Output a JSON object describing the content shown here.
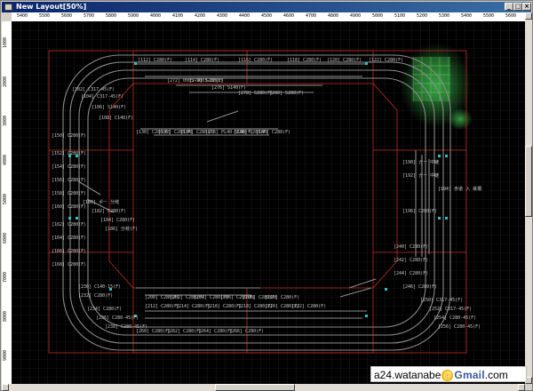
{
  "window": {
    "title": "New Layout[50%]"
  },
  "ruler_top_labels": [
    "5400",
    "5500",
    "5600",
    "5700",
    "5800",
    "5900",
    "4000",
    "4100",
    "4200",
    "4300",
    "4400",
    "4500",
    "4600",
    "4700",
    "4800",
    "4900",
    "5000",
    "5100",
    "5200",
    "5300",
    "5400",
    "5500",
    "5600"
  ],
  "ruler_left_labels": [
    "1000",
    "2000",
    "3000",
    "4000",
    "5000",
    "6000",
    "7000",
    "8000",
    "9000"
  ],
  "track_labels": [
    "[112] C280(F)",
    "[114] C280(F)",
    "[116] C280(F)",
    "[118] C280(F)",
    "[120] C280(F)",
    "[122] C280(F)",
    "[272] 0005-1003-22(L)",
    "[274] S280(F)",
    "[276] S140(F)",
    "[278] S280(F)",
    "[280] S280(F)",
    "[102] C317-45(F)",
    "[104] C317-45(F)",
    "[106] S140(F)",
    "[108] C140(F)",
    "[130] C280(F)",
    "[132] C280(F)",
    "[134] C280(F)",
    "[136] PL40-S140(F)",
    "[138] C280(F)",
    "[140] C280(F)",
    "[150] C280(F)",
    "[152] C280(F)",
    "[154] C280(F)",
    "[156] C280(F)",
    "[158] C280(F)",
    "[160] C280(F)",
    "[162] C280(F)",
    "[164] C280(F)",
    "[166] C280(F)",
    "[168] C280(F)",
    "[180] ポー 分岐",
    "[182] C280(F)",
    "[184] C280(F)",
    "[186] 分岐(F)",
    "[190] ガー 中継",
    "[192] ガー 中継",
    "[194] 歩道 入 鉄橋",
    "[196] C280(F)",
    "[200] C280(F)",
    "[202] C280(F)",
    "[204] C280(F)",
    "[206] C280(F)",
    "[208] C280(F)",
    "[210] C280(F)",
    "[212] C280(F)",
    "[214] C280(F)",
    "[216] C280(F)",
    "[218] C280(F)",
    "[220] C280(F)",
    "[222] C280(F)",
    "[230] C140-15(F)",
    "[232] C280(F)",
    "[234] C280(F)",
    "[236] C280-45(F)",
    "[238] C280-45(F)",
    "[240] C280(F)",
    "[242] C280(F)",
    "[244] C280(F)",
    "[246] C280(F)",
    "[250] C317-45(F)",
    "[252] C317-45(F)",
    "[254] C280-45(F)",
    "[256] C280-45(F)",
    "[260] C280(F)",
    "[262] C280(F)",
    "[264] C280(F)",
    "[266] C280(F)"
  ],
  "watermark": {
    "user": "a24.watanabe",
    "at": "@",
    "brand": "Gmail",
    "tld": ".com"
  },
  "colors": {
    "canvas": "#000000",
    "grid": "#2a2a2a",
    "track": "#8c8c8c",
    "frame": "#c03020",
    "joint": "#30c0c0",
    "green": "#3cb44b"
  }
}
